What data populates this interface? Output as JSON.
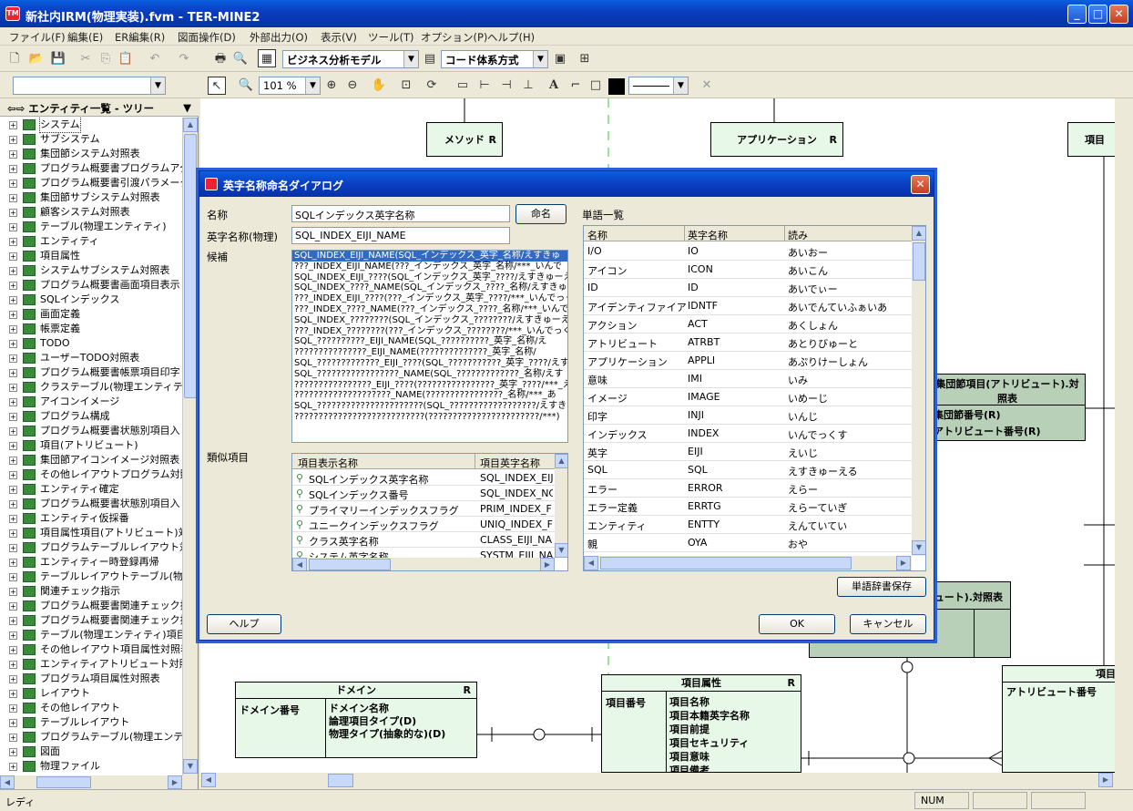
{
  "app": {
    "title": "新社内IRM(物理実装).fvm - TER-MINE2",
    "icon_label": "TM"
  },
  "menu": [
    "ファイル(F)",
    "編集(E)",
    "ER編集(R)",
    "図面操作(D)",
    "外部出力(O)",
    "表示(V)",
    "ツール(T)",
    "オプション(P)",
    "ヘルプ(H)"
  ],
  "toolbar": {
    "model_select": "ビジネス分析モデル",
    "code_select": "コード体系方式",
    "zoom": "101 %"
  },
  "left_panel": {
    "header": "エンティティ一覧 - ツリー",
    "items": [
      "システム",
      "サブシステム",
      "集団節システム対照表",
      "プログラム概要書プログラムアクセ",
      "プログラム概要書引渡パラメータ",
      "集団節サブシステム対照表",
      "顧客システム対照表",
      "テーブル(物理エンティティ)",
      "エンティティ",
      "項目属性",
      "システムサブシステム対照表",
      "プログラム概要書画面項目表示",
      "SQLインデックス",
      "画面定義",
      "帳票定義",
      "TODO",
      "ユーザーTODO対照表",
      "プログラム概要書帳票項目印字",
      "クラステーブル(物理エンティティ).",
      "アイコンイメージ",
      "プログラム構成",
      "プログラム概要書状態別項目入",
      "項目(アトリビュート)",
      "集団節アイコンイメージ対照表",
      "その他レイアウトプログラム対照表",
      "エンティティ確定",
      "プログラム概要書状態別項目入",
      "エンティティ仮採番",
      "項目属性項目(アトリビュート)対",
      "プログラムテーブルレイアウト対照",
      "エンティティー時登録再帰",
      "テーブルレイアウトテーブル(物理",
      "関連チェック指示",
      "プログラム概要書関連チェック指",
      "プログラム概要書関連チェック指",
      "テーブル(物理エンティティ)項目(",
      "その他レイアウト項目属性対照表",
      "エンティティアトリビュート対照表",
      "プログラム項目属性対照表",
      "レイアウト",
      "その他レイアウト",
      "テーブルレイアウト",
      "プログラムテーブル(物理エンティ",
      "図面",
      "物理ファイル"
    ]
  },
  "canvas": {
    "entities": {
      "method": "メソッド",
      "application": "アプリケーション",
      "kou": "項目",
      "domain": "ドメイン",
      "domain_key": "ドメイン番号",
      "domain_attrs": [
        "ドメイン名称",
        "論理項目タイプ(D)",
        "物理タイプ(抽象的な)(D)"
      ],
      "item_attr": "項目属性",
      "item_attr_key": "項目番号",
      "item_attr_attrs": [
        "項目名称",
        "項目本籍英字名称",
        "項目前提",
        "項目セキュリティ",
        "項目意味",
        "項目備考"
      ],
      "rel_title": "集団節項目(アトリビュート).対照表",
      "rel_attrs": [
        "集団節番号(R)",
        "アトリビュート番号(R)"
      ],
      "rel2_title": "ュート).対照表",
      "attr_entity": "項目",
      "attr_key": "アトリビュート番号",
      "r": "R"
    }
  },
  "dialog": {
    "title": "英字名称命名ダイアログ",
    "labels": {
      "name": "名称",
      "phys": "英字名称(物理)",
      "cand": "候補",
      "similar": "類似項目",
      "words": "単語一覧"
    },
    "name_value": "SQLインデックス英字名称",
    "phys_value": "SQL_INDEX_EIJI_NAME",
    "buttons": {
      "name": "命名",
      "save": "単語辞書保存",
      "help": "ヘルプ",
      "ok": "OK",
      "cancel": "キャンセル"
    },
    "candidates": [
      "SQL_INDEX_EIJI_NAME(SQL_インデックス_英字_名称/えすきゅ",
      "???_INDEX_EIJI_NAME(???_インデックス_英字_名称/***_いんで",
      "SQL_INDEX_EIJI_????(SQL_インデックス_英字_????/えすきゅーえ",
      "SQL_INDEX_????_NAME(SQL_インデックス_????_名称/えすきゅ",
      "???_INDEX_EIJI_????(???_インデックス_英字_????/***_いんでっく",
      "???_INDEX_????_NAME(???_インデックス_????_名称/***_いんで",
      "SQL_INDEX_????????(SQL_インデックス_????????/えすきゅーえる",
      "???_INDEX_????????(???_インデックス_????????/***_いんでっくす",
      "SQL_??????????_EIJI_NAME(SQL_??????????_英字_名称/え",
      "???????????????_EIJI_NAME(??????????????_英字_名称/",
      "SQL_?????????????_EIJI_????(SQL_???????????_英字_????/えす",
      "SQL_?????????????????_NAME(SQL_?????????????_名称/えす",
      "????????????????_EIJI_????(????????????????_英字_????/***_え",
      "????????????????????_NAME(????????????????_名称/***_あ",
      "SQL_??????????????????????(SQL_??????????????????/えすきゅ",
      "???????????????????????????(???????????????????????/***)"
    ],
    "similar_cols": [
      "項目表示名称",
      "項目英字名称"
    ],
    "similar_rows": [
      [
        "SQLインデックス英字名称",
        "SQL_INDEX_EIJ"
      ],
      [
        "SQLインデックス番号",
        "SQL_INDEX_NC"
      ],
      [
        "プライマリーインデックスフラグ",
        "PRIM_INDEX_F"
      ],
      [
        "ユニークインデックスフラグ",
        "UNIQ_INDEX_F"
      ],
      [
        "クラス英字名称",
        "CLASS_EIJI_NA"
      ],
      [
        "システム英字名称",
        "SYSTM_EIJI_NA"
      ]
    ],
    "word_cols": [
      "名称",
      "英字名称",
      "読み"
    ],
    "word_rows": [
      [
        "I/O",
        "IO",
        "あいおー"
      ],
      [
        "アイコン",
        "ICON",
        "あいこん"
      ],
      [
        "ID",
        "ID",
        "あいでぃー"
      ],
      [
        "アイデンティファイア",
        "IDNTF",
        "あいでんていふぁいあ"
      ],
      [
        "アクション",
        "ACT",
        "あくしょん"
      ],
      [
        "アトリビュート",
        "ATRBT",
        "あとりびゅーと"
      ],
      [
        "アプリケーション",
        "APPLI",
        "あぷりけーしょん"
      ],
      [
        "意味",
        "IMI",
        "いみ"
      ],
      [
        "イメージ",
        "IMAGE",
        "いめーじ"
      ],
      [
        "印字",
        "INJI",
        "いんじ"
      ],
      [
        "インデックス",
        "INDEX",
        "いんでっくす"
      ],
      [
        "英字",
        "EIJI",
        "えいじ"
      ],
      [
        "SQL",
        "SQL",
        "えすきゅーえる"
      ],
      [
        "エラー",
        "ERROR",
        "えらー"
      ],
      [
        "エラー定義",
        "ERRTG",
        "えらーていぎ"
      ],
      [
        "エンティティ",
        "ENTTY",
        "えんていてい"
      ],
      [
        "親",
        "OYA",
        "おや"
      ]
    ]
  },
  "status": {
    "text": "レディ",
    "num": "NUM"
  }
}
